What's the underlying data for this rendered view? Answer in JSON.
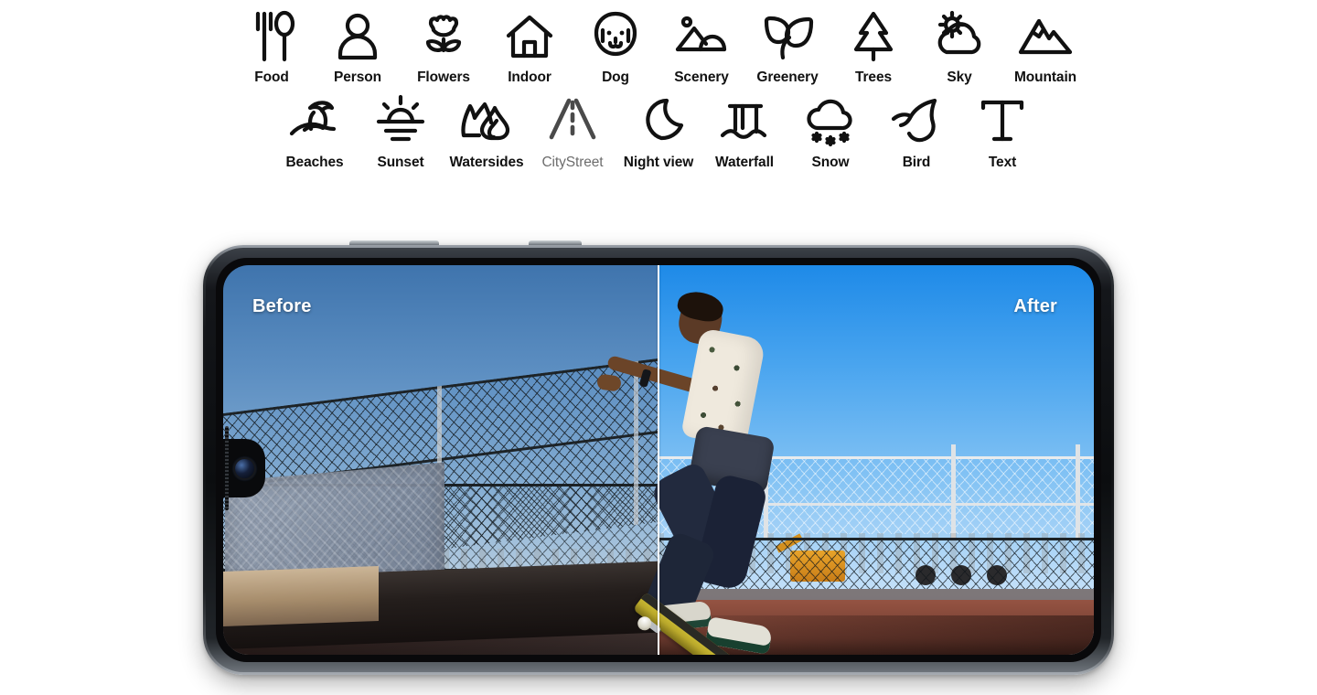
{
  "scene_optimizer": {
    "rows": [
      [
        {
          "label": "Food",
          "icon": "food-icon",
          "muted": false
        },
        {
          "label": "Person",
          "icon": "person-icon",
          "muted": false
        },
        {
          "label": "Flowers",
          "icon": "flowers-icon",
          "muted": false
        },
        {
          "label": "Indoor",
          "icon": "indoor-icon",
          "muted": false
        },
        {
          "label": "Dog",
          "icon": "dog-icon",
          "muted": false
        },
        {
          "label": "Scenery",
          "icon": "scenery-icon",
          "muted": false
        },
        {
          "label": "Greenery",
          "icon": "greenery-icon",
          "muted": false
        },
        {
          "label": "Trees",
          "icon": "trees-icon",
          "muted": false
        },
        {
          "label": "Sky",
          "icon": "sky-icon",
          "muted": false
        },
        {
          "label": "Mountain",
          "icon": "mountain-icon",
          "muted": false
        }
      ],
      [
        {
          "label": "Beaches",
          "icon": "beach-umbrella-icon",
          "muted": false
        },
        {
          "label": "Sunset",
          "icon": "sunset-icon",
          "muted": false
        },
        {
          "label": "Watersides",
          "icon": "watersides-icon",
          "muted": false
        },
        {
          "label": "CityStreet",
          "icon": "city-street-icon",
          "muted": true
        },
        {
          "label": "Night view",
          "icon": "moon-icon",
          "muted": false
        },
        {
          "label": "Waterfall",
          "icon": "waterfall-icon",
          "muted": false
        },
        {
          "label": "Snow",
          "icon": "snow-cloud-icon",
          "muted": false
        },
        {
          "label": "Bird",
          "icon": "bird-icon",
          "muted": false
        },
        {
          "label": "Text",
          "icon": "text-icon",
          "muted": false
        }
      ]
    ]
  },
  "phone": {
    "orientation": "landscape",
    "frame_color": "#14161a",
    "camera": "front-camera-punch-hole",
    "buttons": [
      "volume-rocker",
      "power-button"
    ]
  },
  "comparison": {
    "before_label": "Before",
    "after_label": "After",
    "label_color": "#ffffff",
    "divider_color": "#ffffff",
    "scene": "skateboarder performing a trick on a ramp in front of a chain-link fence",
    "before": {
      "sky_top": "#3f74ad",
      "sky_bottom": "#d8e1e8",
      "ground": "#4a3a38",
      "description": "muted, lower contrast, cooler and darker tones"
    },
    "after": {
      "sky_top": "#1e8ae8",
      "sky_bottom": "#e2eef9",
      "ground": "#8d4e3e",
      "description": "brighter, more saturated blue sky and warmer ground"
    }
  },
  "colors": {
    "background": "#ffffff",
    "icon": "#111111",
    "icon_muted": "#6d6d6d"
  }
}
